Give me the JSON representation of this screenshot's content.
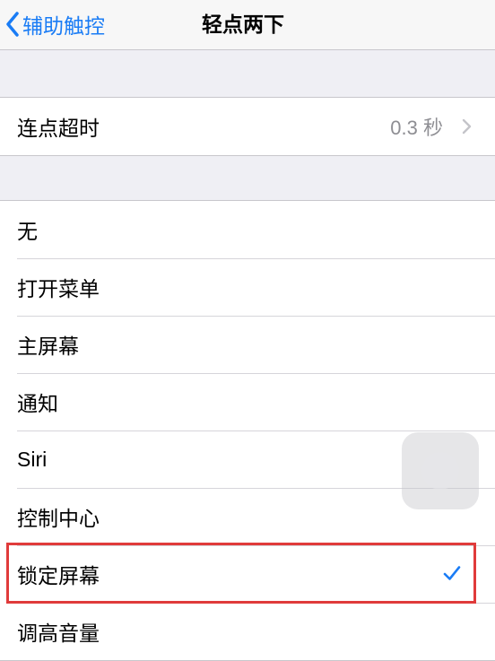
{
  "navbar": {
    "back_label": "辅助触控",
    "title": "轻点两下"
  },
  "timeout_group": {
    "label": "连点超时",
    "value": "0.3 秒"
  },
  "actions": [
    {
      "label": "无",
      "selected": false
    },
    {
      "label": "打开菜单",
      "selected": false
    },
    {
      "label": "主屏幕",
      "selected": false
    },
    {
      "label": "通知",
      "selected": false
    },
    {
      "label": "Siri",
      "selected": false
    },
    {
      "label": "控制中心",
      "selected": false
    },
    {
      "label": "锁定屏幕",
      "selected": true
    },
    {
      "label": "调高音量",
      "selected": false
    }
  ],
  "colors": {
    "accent": "#1a7cf5",
    "highlight_box": "#e03b3b"
  }
}
